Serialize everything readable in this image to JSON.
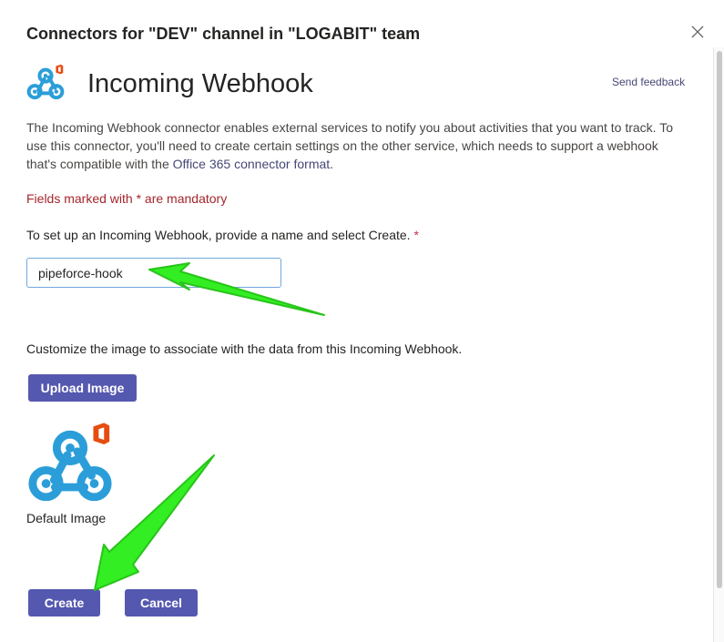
{
  "dialog": {
    "title": "Connectors for \"DEV\" channel in \"LOGABIT\" team",
    "close_icon": "close-icon"
  },
  "connector": {
    "name": "Incoming Webhook",
    "logo_icon": "webhook-office-logo-icon",
    "send_feedback": "Send feedback"
  },
  "description": {
    "text_before": "The Incoming Webhook connector enables external services to notify you about activities that you want to track. To use this connector, you'll need to create certain settings on the other service, which needs to support a webhook that's compatible with the ",
    "link": "Office 365 connector format",
    "text_after": "."
  },
  "form": {
    "mandatory_note": "Fields marked with * are mandatory",
    "name_prompt": "To set up an Incoming Webhook, provide a name and select Create.",
    "required_marker": "*",
    "name_value": "pipeforce-hook",
    "image_prompt": "Customize the image to associate with the data from this Incoming Webhook.",
    "upload_label": "Upload Image",
    "default_image_caption": "Default Image"
  },
  "actions": {
    "create_label": "Create",
    "cancel_label": "Cancel"
  },
  "colors": {
    "accent": "#5558af",
    "link": "#464775",
    "error": "#a4262c",
    "logo_blue": "#2b9ed9",
    "office_red": "#e74c0f",
    "annotation_arrow": "#33ee22"
  }
}
